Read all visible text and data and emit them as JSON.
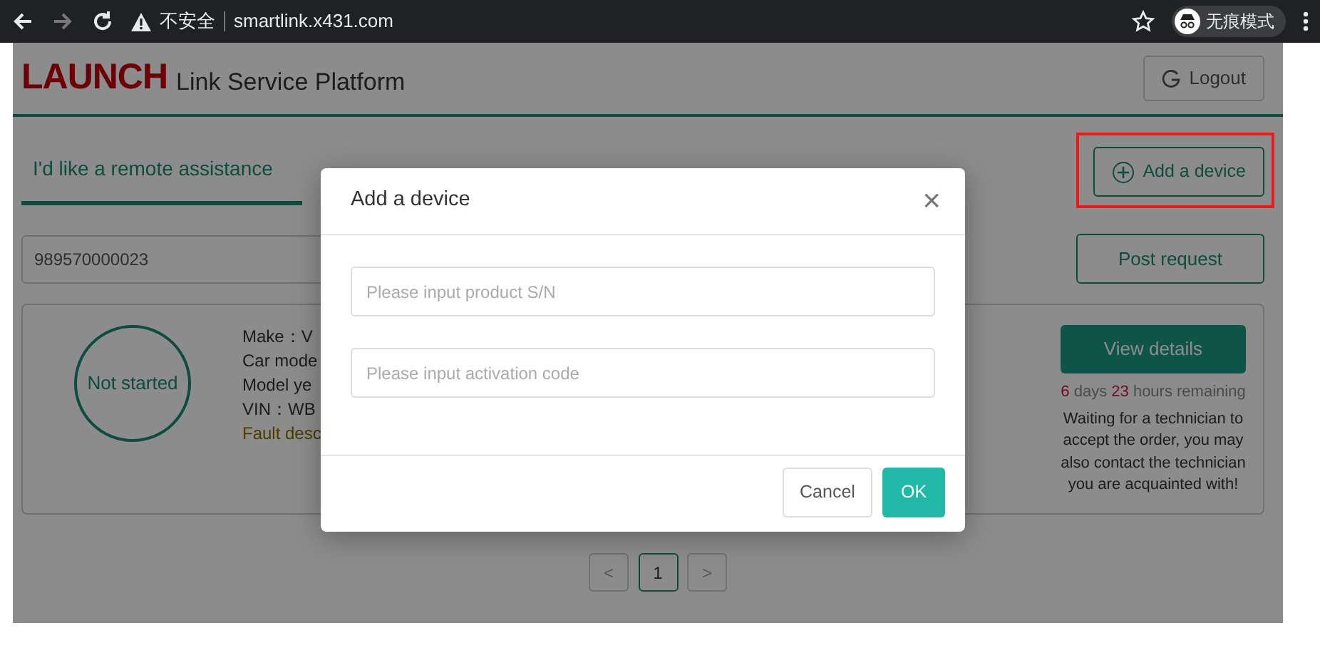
{
  "browser": {
    "security": "不安全",
    "url": "smartlink.x431.com",
    "profile": "无痕模式",
    "forward_disabled": true
  },
  "header": {
    "brand": "LAUNCH",
    "subtitle": "Link Service Platform",
    "logout": "Logout"
  },
  "tabs": [
    {
      "label": "I'd like a remote assistance",
      "selected": true
    }
  ],
  "add_device": {
    "label": "Add a device",
    "highlighted": true
  },
  "request": {
    "value": "989570000023",
    "button": "Post request"
  },
  "order": {
    "status": "Not started",
    "details": [
      "Make：V",
      "Car mode",
      "Model ye",
      "VIN：WB",
      "Fault desc"
    ],
    "view": "View details",
    "remaining": {
      "days": "6",
      "days_label": "days",
      "hours": "23",
      "hours_label": "hours remaining"
    },
    "note": "Waiting for a technician to accept the order, you may also contact the technician you are acquainted with!"
  },
  "pagination": {
    "prev": "<",
    "pages": [
      {
        "label": "1",
        "selected": true
      }
    ],
    "next": ">"
  },
  "modal": {
    "title": "Add a device",
    "close": "×",
    "fields": [
      {
        "placeholder": "Please input product S/N"
      },
      {
        "placeholder": "Please input activation code"
      }
    ],
    "cancel": "Cancel",
    "ok": "OK"
  }
}
